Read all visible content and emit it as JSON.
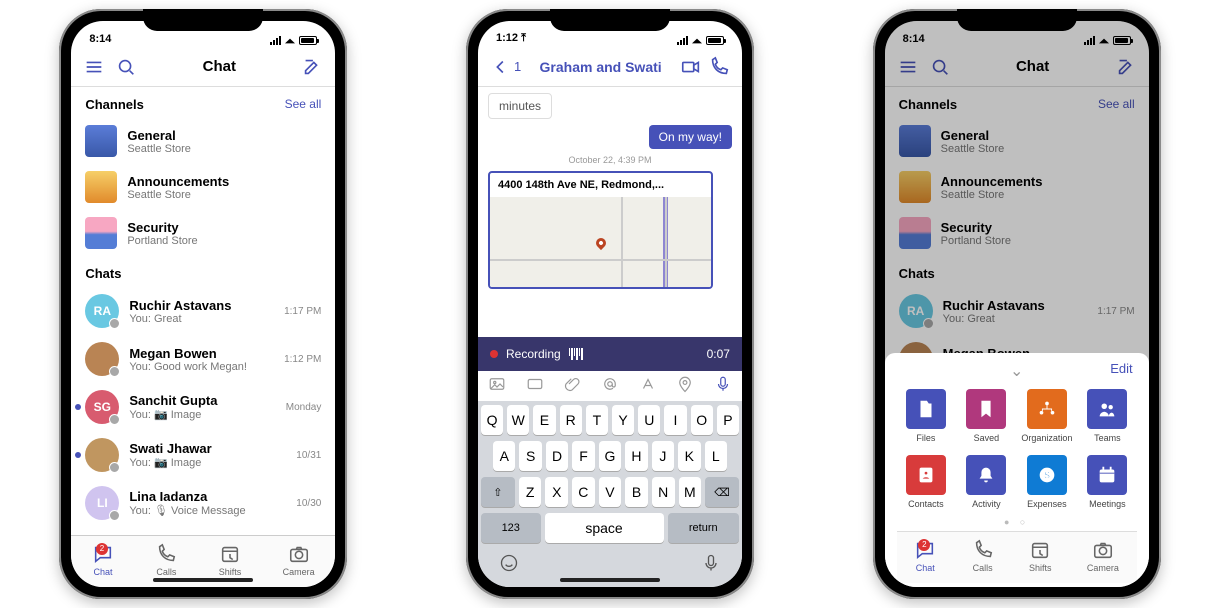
{
  "colors": {
    "brand": "#4651b8",
    "tiles": {
      "files": "#4651b8",
      "saved": "#b0387d",
      "organization": "#e26b1d",
      "teams": "#4651b8",
      "contacts": "#d83b3b",
      "activity": "#4651b8",
      "expenses": "#0f7bd4",
      "meetings": "#4651b8"
    }
  },
  "phone1": {
    "status_time": "8:14",
    "nav_title": "Chat",
    "section_channels": "Channels",
    "see_all": "See all",
    "channels": [
      {
        "name": "General",
        "sub": "Seattle Store",
        "style": "blue"
      },
      {
        "name": "Announcements",
        "sub": "Seattle Store",
        "style": "yellow"
      },
      {
        "name": "Security",
        "sub": "Portland Store",
        "style": "pink"
      }
    ],
    "section_chats": "Chats",
    "chats": [
      {
        "name": "Ruchir Astavans",
        "sub": "You: Great",
        "time": "1:17 PM",
        "avatar": "RA",
        "bg": "#69c8e2",
        "unread": false
      },
      {
        "name": "Megan Bowen",
        "sub": "You: Good work Megan!",
        "time": "1:12 PM",
        "avatar": "",
        "bg": "#b98454",
        "unread": false
      },
      {
        "name": "Sanchit Gupta",
        "sub": "You: 📷 Image",
        "time": "Monday",
        "avatar": "SG",
        "bg": "#d85b6f",
        "unread": true
      },
      {
        "name": "Swati Jhawar",
        "sub": "You: 📷 Image",
        "time": "10/31",
        "avatar": "",
        "bg": "#c09660",
        "unread": true
      },
      {
        "name": "Lina Iadanza",
        "sub": "You: 🎙 Voice Message",
        "time": "10/30",
        "avatar": "LI",
        "bg": "#d0c4ef",
        "unread": false
      }
    ],
    "tabs": [
      {
        "label": "Chat",
        "active": true,
        "badge": "2"
      },
      {
        "label": "Calls",
        "active": false
      },
      {
        "label": "Shifts",
        "active": false
      },
      {
        "label": "Camera",
        "active": false
      }
    ]
  },
  "phone2": {
    "status_time": "1:12",
    "back_badge": "1",
    "nav_title": "Graham and Swati",
    "incoming_text": "minutes",
    "outgoing_text": "On my way!",
    "timestamp": "October 22, 4:39 PM",
    "map_address": "4400 148th Ave NE,  Redmond,...",
    "recording_label": "Recording",
    "recording_time": "0:07",
    "kb_rows": [
      [
        "Q",
        "W",
        "E",
        "R",
        "T",
        "Y",
        "U",
        "I",
        "O",
        "P"
      ],
      [
        "A",
        "S",
        "D",
        "F",
        "G",
        "H",
        "J",
        "K",
        "L"
      ],
      [
        "Z",
        "X",
        "C",
        "V",
        "B",
        "N",
        "M"
      ]
    ],
    "kb_123": "123",
    "kb_space": "space",
    "kb_return": "return"
  },
  "phone3": {
    "status_time": "8:14",
    "nav_title": "Chat",
    "edit": "Edit",
    "sheet_items_row1": [
      {
        "key": "files",
        "label": "Files"
      },
      {
        "key": "saved",
        "label": "Saved"
      },
      {
        "key": "organization",
        "label": "Organization"
      },
      {
        "key": "teams",
        "label": "Teams"
      }
    ],
    "sheet_items_row2": [
      {
        "key": "contacts",
        "label": "Contacts"
      },
      {
        "key": "activity",
        "label": "Activity"
      },
      {
        "key": "expenses",
        "label": "Expenses"
      },
      {
        "key": "meetings",
        "label": "Meetings"
      }
    ]
  }
}
